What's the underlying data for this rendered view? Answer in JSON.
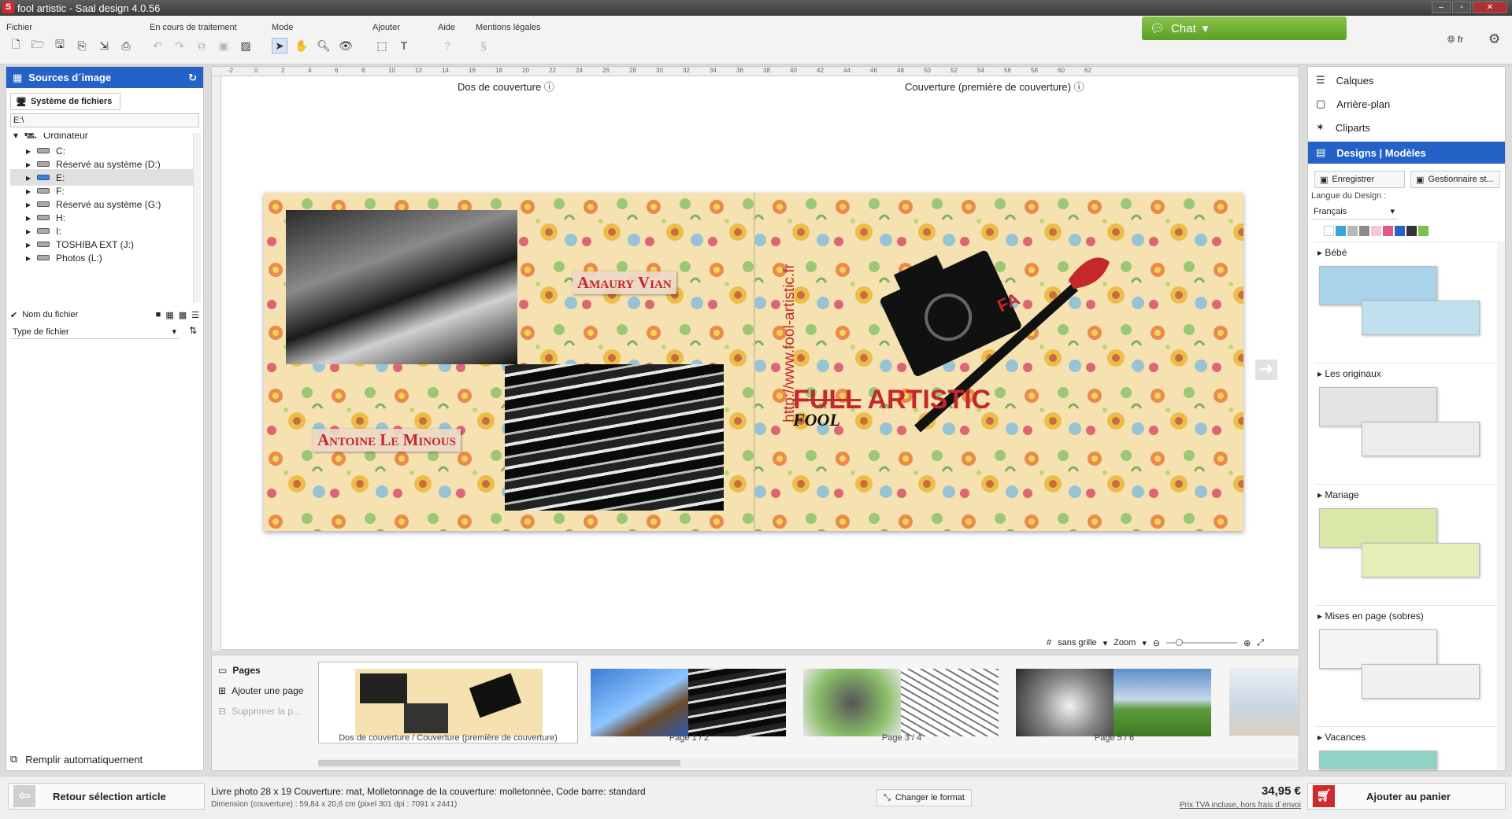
{
  "window": {
    "title": "fool artistic - Saal design 4.0.56",
    "logo_letter": "S"
  },
  "ribbon": {
    "groups": [
      {
        "label": "Fichier"
      },
      {
        "label": "En cours de traitement"
      },
      {
        "label": "Mode"
      },
      {
        "label": "Ajouter"
      },
      {
        "label": "Aide"
      },
      {
        "label": "Mentions légales"
      }
    ],
    "help_icon": "?",
    "legal_icon": "§",
    "chat_label": "Chat",
    "language": "fr"
  },
  "left_panel": {
    "title": "Sources d´image",
    "tab": "Système de fichiers",
    "path": "E:\\",
    "tree_root": "Ordinateur",
    "tree": [
      {
        "label": "C:"
      },
      {
        "label": "Réservé au système (D:)"
      },
      {
        "label": "E:",
        "selected": true
      },
      {
        "label": "F:"
      },
      {
        "label": "Réservé au système (G:)"
      },
      {
        "label": "H:"
      },
      {
        "label": "I:"
      },
      {
        "label": "TOSHIBA EXT (J:)"
      },
      {
        "label": "Photos (L:)"
      }
    ],
    "filename_checkbox": "Nom du fichier",
    "filetype": "Type de fichier",
    "autofill": "Remplir automatiquement"
  },
  "canvas": {
    "label_back": "Dos de couverture",
    "label_front": "Couverture (première de couverture)",
    "name1": "Amaury Vian",
    "name2": "Antoine Le Minous",
    "url": "http://www.fool-artistic.fr",
    "logo_main": "ARTISTIC",
    "logo_struck": "FULL",
    "logo_sub": "FOOL",
    "logo_badge": "FA",
    "grid_label": "sans grille",
    "zoom_label": "Zoom",
    "ruler_ticks": [
      "-2",
      "0",
      "2",
      "4",
      "6",
      "8",
      "10",
      "12",
      "14",
      "16",
      "18",
      "20",
      "22",
      "24",
      "26",
      "28",
      "30",
      "32",
      "34",
      "36",
      "38",
      "40",
      "42",
      "44",
      "46",
      "48",
      "50",
      "52",
      "54",
      "56",
      "58",
      "60",
      "62"
    ]
  },
  "pages": {
    "title": "Pages",
    "add": "Ajouter une page",
    "remove": "Supprimer la p...",
    "thumbs": [
      {
        "label": "Dos de couverture / Couverture (première de couverture)",
        "selected": true
      },
      {
        "label": "Page 1 / 2"
      },
      {
        "label": "Page 3 / 4"
      },
      {
        "label": "Page 5 / 6"
      }
    ]
  },
  "right_panel": {
    "items": [
      {
        "label": "Calques"
      },
      {
        "label": "Arrière-plan"
      },
      {
        "label": "Cliparts"
      },
      {
        "label": "Designs | Modèles",
        "active": true
      }
    ],
    "save": "Enregistrer",
    "manager": "Gestionnaire st...",
    "design_lang_label": "Langue du Design :",
    "design_lang": "Français",
    "swatches": [
      "#ffffff",
      "#3aa6d8",
      "#b8b8b8",
      "#8c8c8c",
      "#f7c6d4",
      "#e0588a",
      "#2462c7",
      "#333333",
      "#7cc04a"
    ],
    "categories": [
      {
        "title": "Bébé"
      },
      {
        "title": "Les originaux"
      },
      {
        "title": "Mariage"
      },
      {
        "title": "Mises en page (sobres)"
      },
      {
        "title": "Vacances"
      }
    ]
  },
  "status": {
    "back": "Retour sélection article",
    "article": "Livre photo 28 x 19 Couverture: mat, Molletonnage de la couverture: molletonnée, Code barre: standard",
    "dimension": "Dimension (couverture) : 59,84 x 20,6 cm (pixel 301 dpi : 7091 x 2441)",
    "change_format": "Changer le format",
    "price": "34,95 €",
    "price_note": "Prix TVA incluse, hors frais d´envoi",
    "add_to_cart": "Ajouter au panier"
  },
  "colors": {
    "accent": "#2462c7",
    "chat": "#6db33f",
    "brand_red": "#c4282a"
  }
}
